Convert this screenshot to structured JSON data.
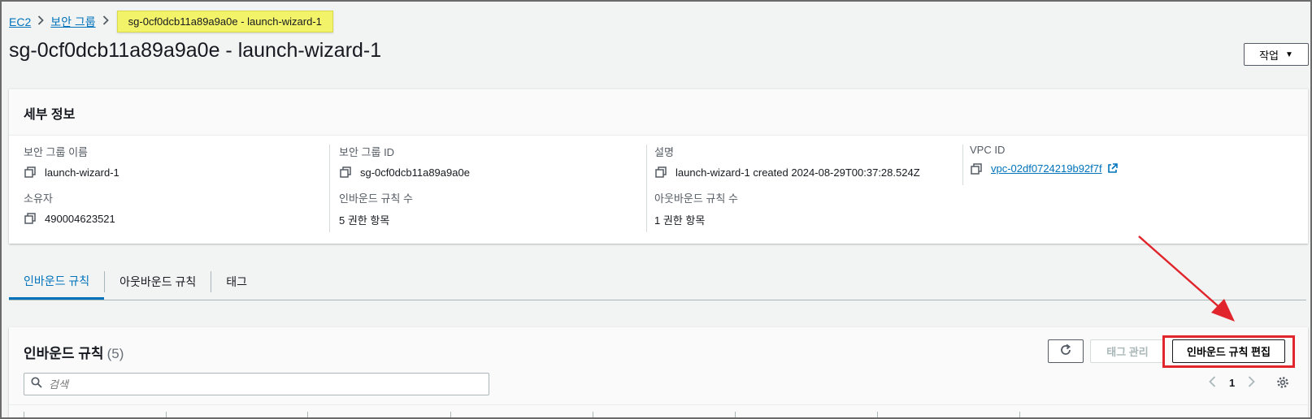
{
  "breadcrumb": {
    "items": [
      "EC2",
      "보안 그룹"
    ],
    "current": "sg-0cf0dcb11a89a9a0e - launch-wizard-1"
  },
  "page": {
    "title": "sg-0cf0dcb11a89a9a0e - launch-wizard-1",
    "action_label": "작업"
  },
  "details": {
    "header": "세부 정보",
    "fields": {
      "sg_name": {
        "label": "보안 그룹 이름",
        "value": "launch-wizard-1"
      },
      "sg_id": {
        "label": "보안 그룹 ID",
        "value": "sg-0cf0dcb11a89a9a0e"
      },
      "description": {
        "label": "설명",
        "value": "launch-wizard-1 created 2024-08-29T00:37:28.524Z"
      },
      "vpc_id": {
        "label": "VPC ID",
        "value": "vpc-02df0724219b92f7f"
      },
      "owner": {
        "label": "소유자",
        "value": "490004623521"
      },
      "inbound_count": {
        "label": "인바운드 규칙 수",
        "value": "5 권한 항목"
      },
      "outbound_count": {
        "label": "아웃바운드 규칙 수",
        "value": "1 권한 항목"
      }
    }
  },
  "tabs": [
    {
      "label": "인바운드 규칙",
      "active": true
    },
    {
      "label": "아웃바운드 규칙",
      "active": false
    },
    {
      "label": "태그",
      "active": false
    }
  ],
  "inbound": {
    "title": "인바운드 규칙",
    "count": "(5)",
    "tag_button": "태그 관리",
    "edit_button": "인바운드 규칙 편집",
    "search_placeholder": "검색",
    "page_number": "1"
  },
  "colors": {
    "link": "#0073bb",
    "highlight": "#f3f36a",
    "annotation_red": "#e0262c"
  },
  "icons": [
    "copy-icon",
    "external-link-icon",
    "refresh-icon",
    "search-icon",
    "settings-icon",
    "chevron-left-icon",
    "chevron-right-icon",
    "caret-down-icon"
  ]
}
